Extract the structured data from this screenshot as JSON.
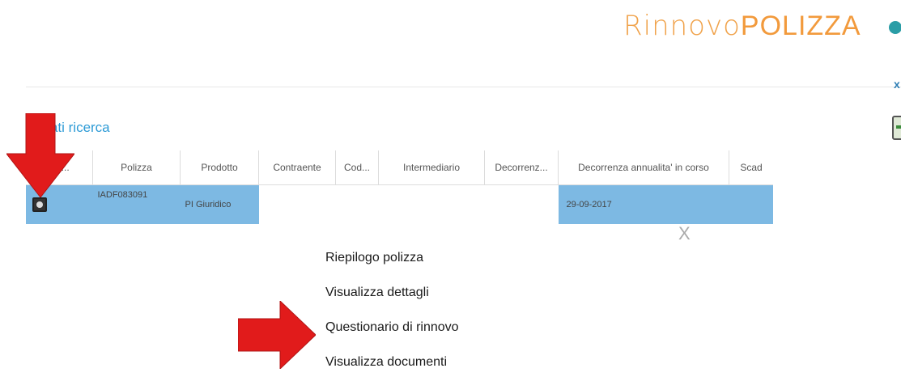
{
  "brand": {
    "part1": "Rinnovo",
    "part2": "POLIZZA"
  },
  "top_close_label": "x",
  "results": {
    "title": "ultati ricerca"
  },
  "table": {
    "columns": [
      "Do...",
      "Polizza",
      "Prodotto",
      "Contraente",
      "Cod...",
      "Intermediario",
      "Decorrenz...",
      "Decorrenza annualita' in corso",
      "Scad"
    ],
    "selected_row": {
      "polizza": "IADF083091",
      "prodotto": "PI Giuridico",
      "decorrenza_annualita": "29-09-2017"
    }
  },
  "popup": {
    "close_label": "X",
    "items": [
      "Riepilogo polizza",
      "Visualizza dettagli",
      "Questionario di rinnovo",
      "Visualizza documenti"
    ]
  },
  "colors": {
    "selected_row": "#7db9e3",
    "link": "#2e9bd6",
    "brand_orange": "#f0a24a",
    "arrow_red": "#e11b1b"
  },
  "icons": [
    "row-select-icon",
    "export-excel-icon",
    "red-arrow-icon"
  ]
}
